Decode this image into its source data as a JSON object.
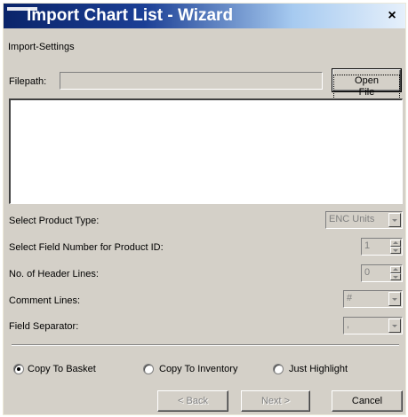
{
  "window": {
    "title": "Import Chart List - Wizard",
    "close_glyph": "×"
  },
  "import_settings": {
    "group_label": "Import-Settings"
  },
  "filepath": {
    "label": "Filepath:",
    "value": ""
  },
  "open_file_button": {
    "label": "Open File"
  },
  "product_type": {
    "label": "Select Product Type:",
    "value": "ENC Units"
  },
  "field_number": {
    "label": "Select Field Number for Product ID:",
    "value": "1"
  },
  "header_lines": {
    "label": "No. of Header Lines:",
    "value": "0"
  },
  "comment_lines": {
    "label": "Comment Lines:",
    "value": "#"
  },
  "field_separator": {
    "label": "Field Separator:",
    "value": ","
  },
  "radios": {
    "copy_to_basket": {
      "label": "Copy To Basket",
      "checked": true
    },
    "copy_to_inventory": {
      "label": "Copy To Inventory",
      "checked": false
    },
    "just_highlight": {
      "label": "Just Highlight",
      "checked": false
    }
  },
  "buttons": {
    "back": "< Back",
    "next": "Next >",
    "cancel": "Cancel"
  }
}
